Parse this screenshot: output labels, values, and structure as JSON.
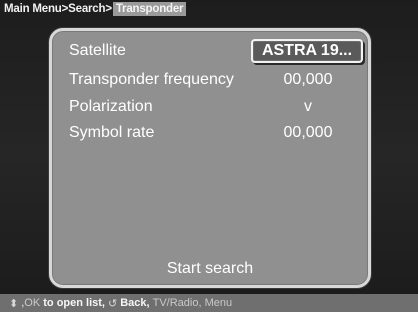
{
  "breadcrumb": {
    "items": [
      "Main Menu",
      "Search",
      "Transponder"
    ],
    "separator": ">"
  },
  "menu": {
    "rows": [
      {
        "label": "Satellite",
        "value": "ASTRA 19..."
      },
      {
        "label": "Transponder frequency",
        "value": "00,000"
      },
      {
        "label": "Polarization",
        "value": "v"
      },
      {
        "label": "Symbol rate",
        "value": "00,000"
      }
    ],
    "start_search": "Start search"
  },
  "footer": {
    "updown_icon": "up-down-arrows-icon",
    "sep1": ", ",
    "ok_text": "OK",
    "open_list_text": "to open list,",
    "back_icon": "back-arrow-icon",
    "back_text": "Back,",
    "tvradio_text": "TV/Radio,",
    "menu_text": "Menu"
  }
}
